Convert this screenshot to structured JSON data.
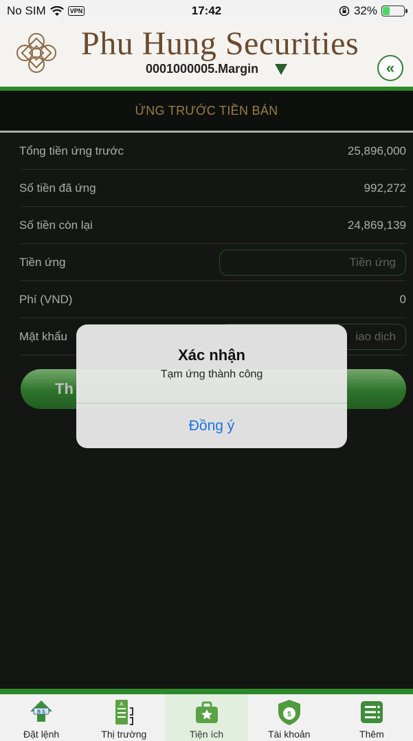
{
  "status_bar": {
    "carrier": "No SIM",
    "vpn": "VPN",
    "time": "17:42",
    "battery": "32%",
    "battery_level": 0.32
  },
  "header": {
    "brand_name": "Phu Hung Securities",
    "account": "0001000005.Margin"
  },
  "page": {
    "title": "ỨNG TRƯỚC TIỀN BÁN"
  },
  "form": {
    "total_advance_label": "Tổng tiền ứng trước",
    "total_advance_value": "25,896,000",
    "advanced_label": "Số tiền đã ứng",
    "advanced_value": "992,272",
    "remaining_label": "Số tiền còn lại",
    "remaining_value": "24,869,139",
    "advance_amount_label": "Tiền ứng",
    "advance_amount_placeholder": "Tiền ứng",
    "fee_label": "Phí (VND)",
    "fee_value": "0",
    "password_label": "Mật khẩu",
    "password_placeholder": "iao dịch",
    "submit_label": "Th"
  },
  "alert": {
    "title": "Xác nhận",
    "message": "Tạm ứng thành công",
    "confirm_label": "Đồng ý"
  },
  "tabs": [
    {
      "label": "Đặt lệnh",
      "icon": "order-icon"
    },
    {
      "label": "Thị trường",
      "icon": "market-icon"
    },
    {
      "label": "Tiện ích",
      "icon": "utilities-icon"
    },
    {
      "label": "Tài khoản",
      "icon": "account-icon"
    },
    {
      "label": "Thêm",
      "icon": "more-icon"
    }
  ],
  "colors": {
    "brand_green": "#2d8a2a",
    "title_gold": "#c9a95a",
    "link_blue": "#1a73e8"
  }
}
